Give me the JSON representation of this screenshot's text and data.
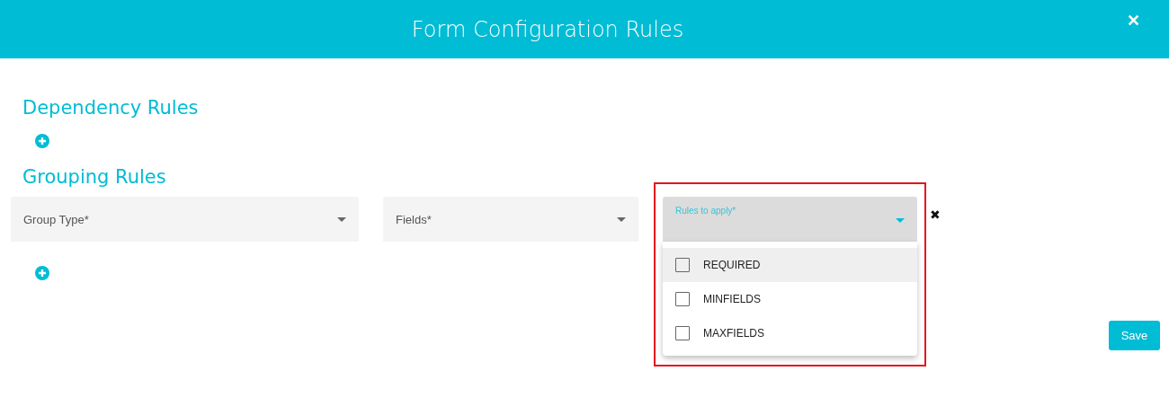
{
  "dialog": {
    "title": "Form Configuration Rules",
    "close": "✕"
  },
  "dependency_rules": {
    "heading": "Dependency Rules"
  },
  "grouping_rules": {
    "heading": "Grouping Rules",
    "fields": [
      {
        "kind": "select",
        "label": "Group Type*",
        "focused": false
      },
      {
        "kind": "select",
        "label": "Fields*",
        "focused": false
      },
      {
        "kind": "select",
        "label": "Rules to apply*",
        "focused": true,
        "highlighted": true
      }
    ],
    "remove": "✖",
    "menu": [
      {
        "label": "REQUIRED",
        "checked": false,
        "hovered": true
      },
      {
        "label": "MINFIELDS",
        "checked": false,
        "hovered": false
      },
      {
        "label": "MAXFIELDS",
        "checked": false,
        "hovered": false
      }
    ]
  },
  "buttons": [
    {
      "label": "Save"
    }
  ]
}
